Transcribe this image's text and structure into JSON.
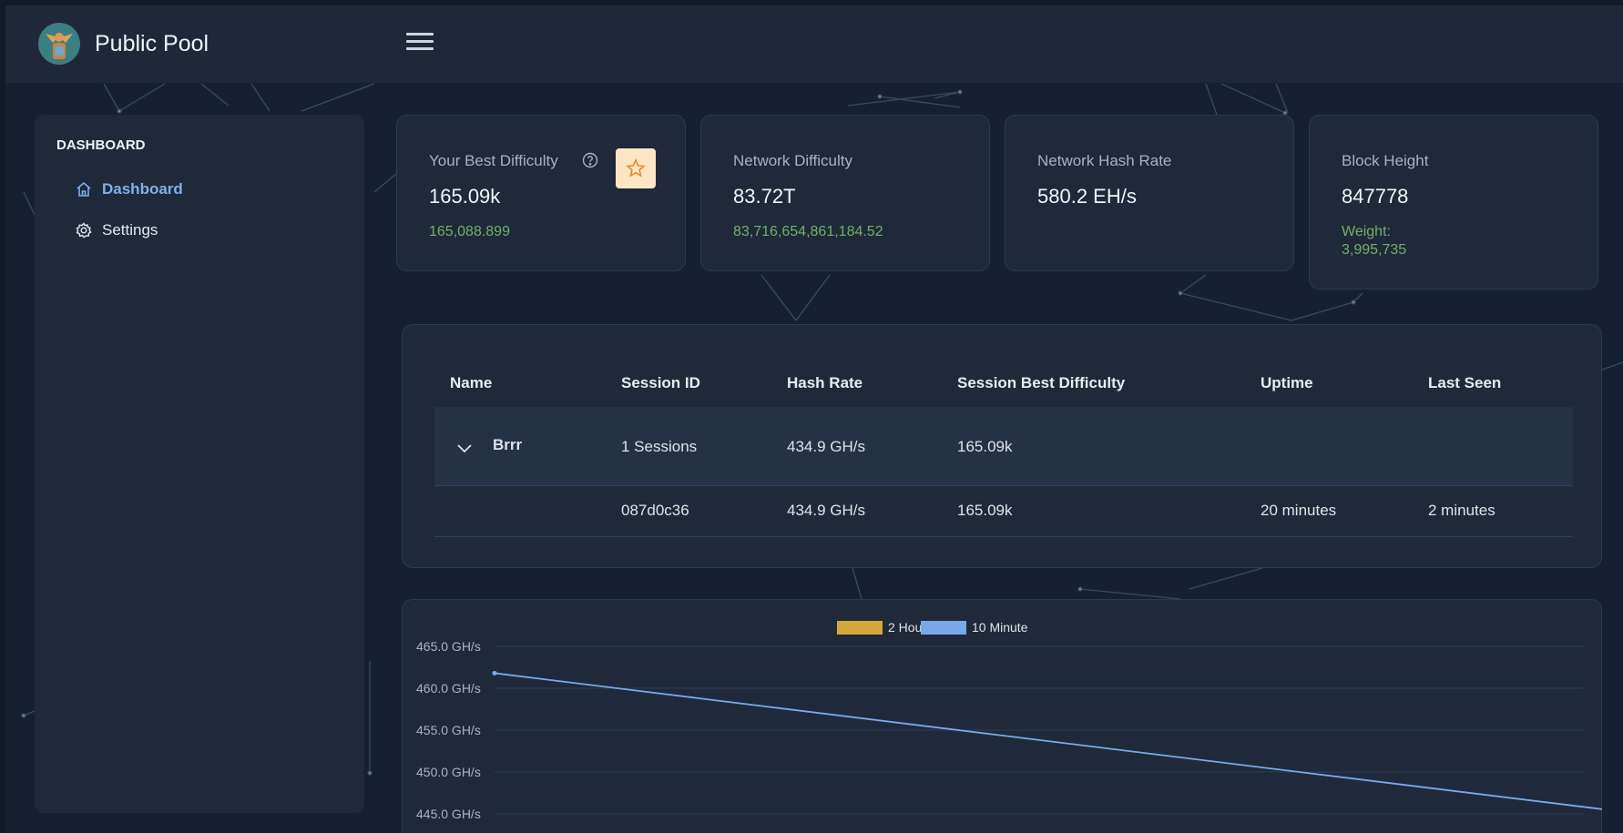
{
  "header": {
    "app_title": "Public Pool",
    "logo_icon": "pool-logo-icon",
    "menu_icon": "hamburger-menu-icon"
  },
  "sidebar": {
    "heading": "DASHBOARD",
    "items": [
      {
        "label": "Dashboard",
        "icon": "home-icon",
        "active": true
      },
      {
        "label": "Settings",
        "icon": "gear-icon",
        "active": false
      }
    ]
  },
  "stats": [
    {
      "label": "Your Best Difficulty",
      "value": "165.09k",
      "sub": "165,088.899"
    },
    {
      "label": "Network Difficulty",
      "value": "83.72T",
      "sub": "83,716,654,861,184.52"
    },
    {
      "label": "Network Hash Rate",
      "value": "580.2 EH/s",
      "sub": ""
    },
    {
      "label": "Block Height",
      "value": "847778",
      "sub_line1": "Weight:",
      "sub_line2": "3,995,735"
    }
  ],
  "workers_table": {
    "columns": [
      "Name",
      "Session ID",
      "Hash Rate",
      "Session Best Difficulty",
      "Uptime",
      "Last Seen"
    ],
    "group": {
      "name": "Brrr",
      "sessions": "1 Sessions",
      "hash_rate": "434.9 GH/s",
      "best_difficulty": "165.09k"
    },
    "sessions": [
      {
        "session_id": "087d0c36",
        "hash_rate": "434.9 GH/s",
        "best_difficulty": "165.09k",
        "uptime": "20 minutes",
        "last_seen": "2 minutes"
      }
    ]
  },
  "colors": {
    "accent": "#7fb0ea",
    "positive": "#6fb16a",
    "series_2h": "#d4a83b",
    "series_10m": "#78aaea"
  },
  "chart_data": {
    "type": "line",
    "ylabel": "",
    "y_ticks": [
      "465.0 GH/s",
      "460.0 GH/s",
      "455.0 GH/s",
      "450.0 GH/s",
      "445.0 GH/s"
    ],
    "ylim": [
      445,
      465
    ],
    "legend": [
      "2 Hour",
      "10 Minute"
    ],
    "legend_placement": "top-center",
    "series": [
      {
        "name": "2 Hour",
        "values": []
      },
      {
        "name": "10 Minute",
        "x": [
          0,
          1
        ],
        "values": [
          461.8,
          444.8
        ]
      }
    ]
  }
}
